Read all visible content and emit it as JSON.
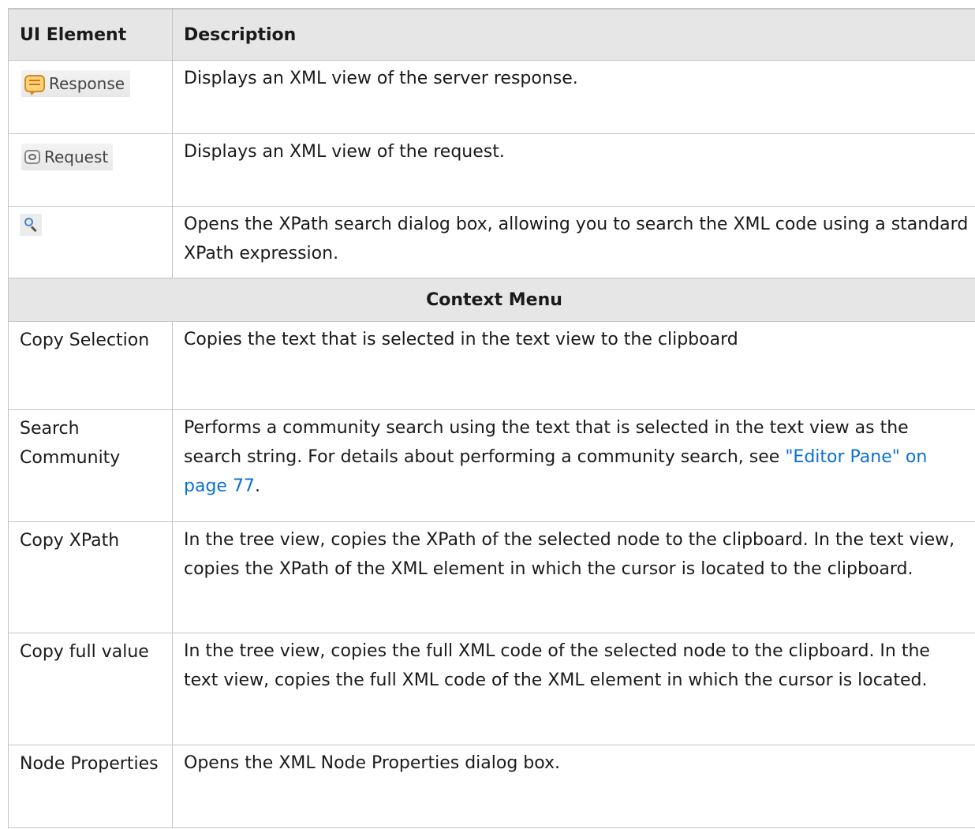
{
  "header": {
    "col1": "UI Element",
    "col2": "Description"
  },
  "rows_top": [
    {
      "element_label": "Response",
      "element_icon": "response-speech-bubble-icon",
      "description": "Displays an XML view of the server response."
    },
    {
      "element_label": "Request",
      "element_icon": "request-speech-bubble-icon",
      "description": "Displays an XML view of the request."
    },
    {
      "element_icon": "search-icon",
      "description": "Opens the XPath search dialog box, allowing you to search the XML code using a standard XPath expression."
    }
  ],
  "section": {
    "title": "Context Menu"
  },
  "rows_menu": [
    {
      "element": "Copy Selection",
      "description": "Copies the text that is selected in the text view to the clipboard"
    },
    {
      "element": "Search Community",
      "description_before_link": "Performs a community search using the text that is selected in the text view as the search string. For details about performing a community search, see ",
      "link_text": "\"Editor Pane\" on page 77",
      "description_after_link": "."
    },
    {
      "element": "Copy XPath",
      "description": "In the tree view, copies the XPath of the selected node to the clipboard. In the text view, copies the XPath of the XML element in which the cursor is located to the clipboard."
    },
    {
      "element": "Copy full value",
      "description": "In the tree view, copies the full XML code of the selected node to the clipboard. In the text view, copies the full XML code of the XML element in which the cursor is located."
    },
    {
      "element": "Node Properties",
      "description": "Opens the XML Node Properties dialog box."
    }
  ],
  "colors": {
    "header_bg": "#e6e6e6",
    "border": "#c4c4c4",
    "link": "#0b6fd6",
    "text": "#1a1a1a"
  }
}
